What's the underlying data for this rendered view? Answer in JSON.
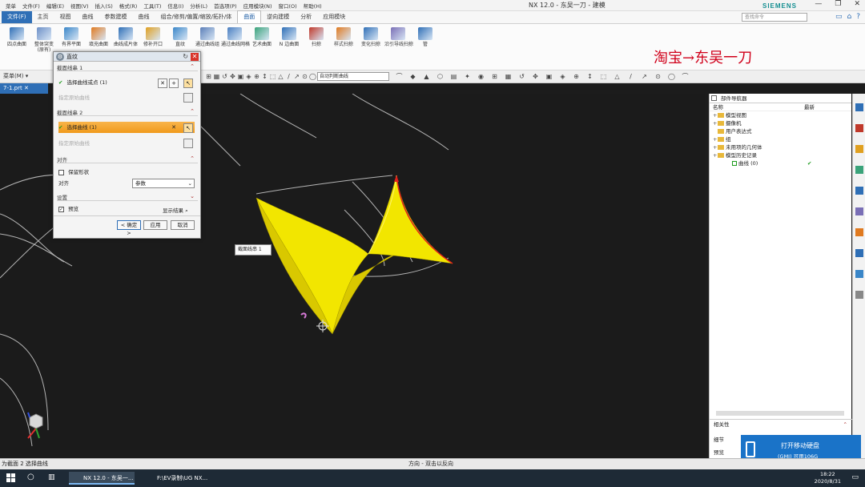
{
  "titlebar": {
    "menus": [
      "菜单",
      "文件(F)",
      "编辑(E)",
      "视图(V)",
      "插入(S)",
      "格式(R)",
      "工具(T)",
      "信息(I)",
      "分析(L)",
      "首选项(P)",
      "应用模块(N)",
      "窗口(O)",
      "帮助(H)"
    ],
    "window_title": "NX 12.0 - 东吴一刀 - 建模",
    "brand": "SIEMENS",
    "min": "—",
    "max": "❐",
    "close": "✕"
  },
  "ribbon_tabs": [
    "文件(F)",
    "主页",
    "视图",
    "曲线",
    "参数建模",
    "曲线",
    "组合/修剪/偏置/缩放/拓扑/体",
    "曲面",
    "逆向建模",
    "分析",
    "应用模块"
  ],
  "ribbon_active_index": 7,
  "search_placeholder": "查找命令",
  "ribbon_tools": [
    "四点曲面",
    "整体突变",
    "有界平面",
    "填充曲面",
    "曲线成片体",
    "修补开口",
    "直纹",
    "通过曲线组",
    "通过曲线网格",
    "艺术曲面",
    "N 边曲面",
    "扫掠",
    "样式扫掠",
    "变化扫掠",
    "沿引导线扫掠",
    "管"
  ],
  "ribbon_tool_sub": "(原有)",
  "watermark": "淘宝→东吴一刀",
  "toolbar2": {
    "menu": "菜单(M) ▾",
    "filter": "自动判断曲线"
  },
  "doc_tab": "7-1.prt ✕",
  "dialog": {
    "title": "直纹",
    "section1": {
      "header": "截面线串 1",
      "select_label": "选择曲线或点 (1)",
      "specify": "指定原始曲线"
    },
    "section2": {
      "header": "截面线串 2",
      "select_label": "选择曲线 (1)",
      "specify": "指定原始曲线"
    },
    "align": {
      "header": "对齐",
      "keep_shape": "保留形状",
      "align_label": "对齐",
      "align_value": "参数"
    },
    "settings": "设置",
    "preview": "预览",
    "show_result": "显示结果",
    "ok": "< 确定 >",
    "apply": "应用",
    "cancel": "取消"
  },
  "tooltip": "截面线串 1",
  "navigator": {
    "title": "部件导航器",
    "col_name": "名称",
    "col_latest": "最新",
    "items": [
      {
        "label": "模型视图",
        "folder": true,
        "plus": true,
        "tick": false
      },
      {
        "label": "摄像机",
        "folder": true,
        "plus": true,
        "tick": false
      },
      {
        "label": "用户表达式",
        "folder": true,
        "plus": false,
        "tick": false
      },
      {
        "label": "组",
        "folder": true,
        "plus": true,
        "tick": false
      },
      {
        "label": "未用项的几何体",
        "folder": true,
        "plus": true,
        "tick": false
      },
      {
        "label": "模型历史记录",
        "folder": true,
        "plus": true,
        "tick": false
      },
      {
        "label": "曲线 (0)",
        "folder": false,
        "plus": false,
        "tick": true
      }
    ],
    "related": "相关性",
    "details": "细节",
    "preview_label": "预览"
  },
  "notify": {
    "title": "打开移动硬盘",
    "sub": "(GMJ)  可用106G"
  },
  "status": {
    "left": "为截面 2 选择曲线",
    "mid": "方向 - 双击以反向"
  },
  "taskbar": {
    "task1": "NX 12.0 - 东吴一...",
    "task2": "F:\\EV录制\\UG NX...",
    "time": "18:22",
    "date": "2020/8/31"
  },
  "colors": {
    "surface": "#f2e600",
    "edge_highlight": "#e0201a",
    "accent": "#2f6fb6",
    "selection": "#f09a1b"
  }
}
